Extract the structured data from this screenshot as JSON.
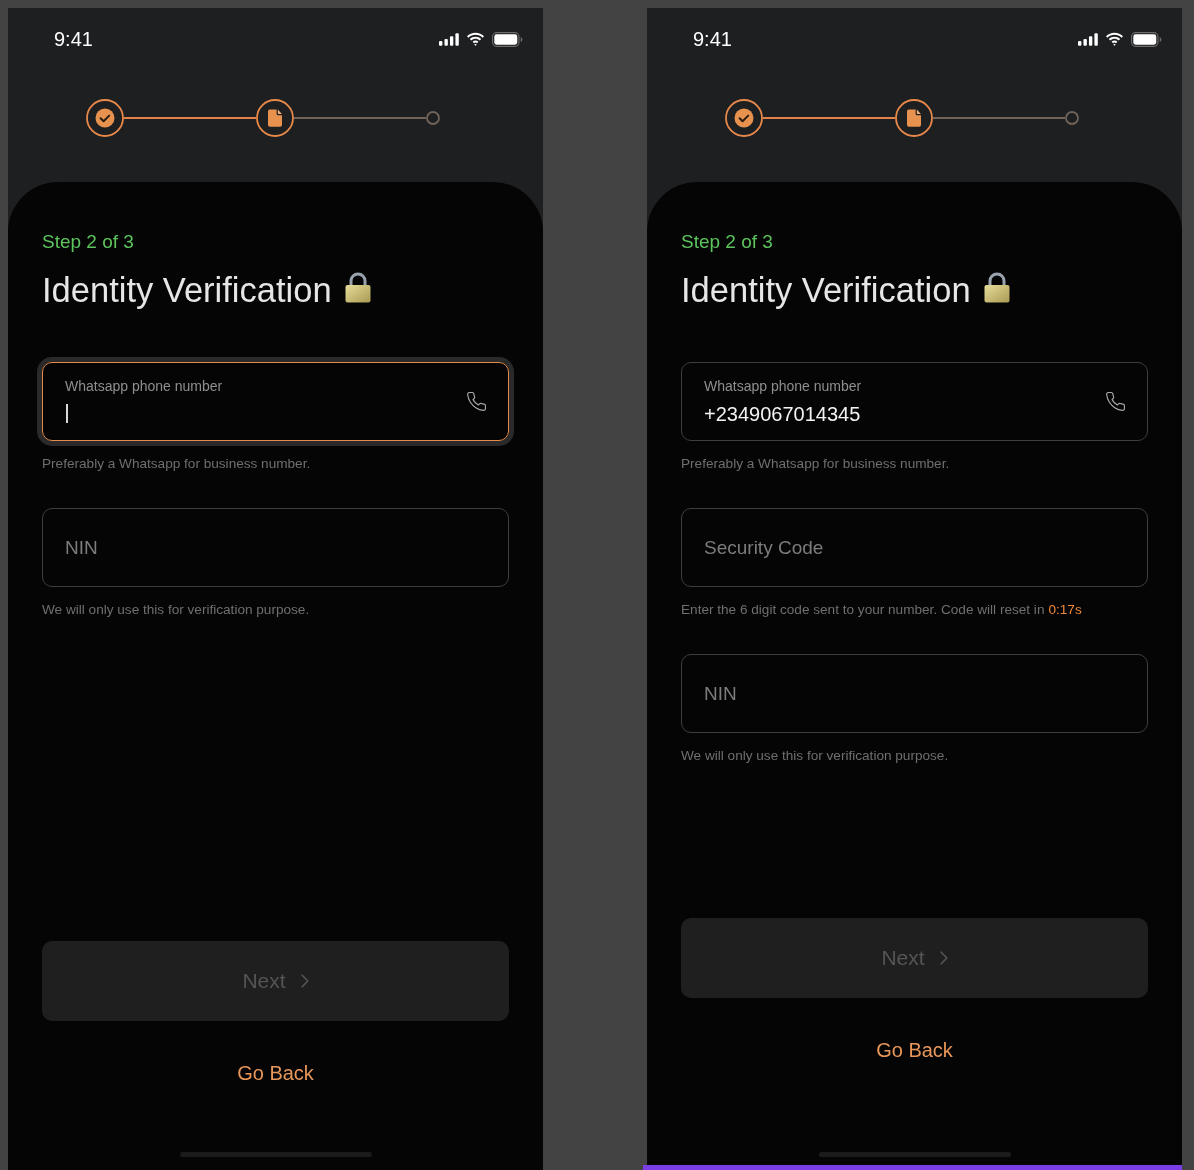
{
  "screens": [
    {
      "selected": false,
      "status_bar": {
        "time": "9:41"
      },
      "stepper": [
        {
          "kind": "done"
        },
        {
          "kind": "current"
        },
        {
          "kind": "pending"
        }
      ],
      "step_label": "Step 2 of 3",
      "title": "Identity Verification",
      "fields": [
        {
          "kind": "phone",
          "label": "Whatsapp phone number",
          "focused": true,
          "helper": "Preferably a Whatsapp for business number."
        },
        {
          "kind": "text",
          "placeholder": "NIN",
          "focused": false,
          "helper": "We will only use this for verification purpose."
        }
      ],
      "next_button": {
        "label": "Next",
        "disabled": true
      },
      "back_link": "Go Back"
    },
    {
      "selected": true,
      "status_bar": {
        "time": "9:41"
      },
      "stepper": [
        {
          "kind": "done"
        },
        {
          "kind": "current"
        },
        {
          "kind": "pending"
        }
      ],
      "step_label": "Step 2 of 3",
      "title": "Identity Verification",
      "fields": [
        {
          "kind": "phone",
          "label": "Whatsapp phone number",
          "value": "+2349067014345",
          "focused": false,
          "helper": "Preferably a Whatsapp for business number."
        },
        {
          "kind": "text",
          "placeholder": "Security Code",
          "focused": false,
          "helper": "Enter the 6 digit code sent to your number. Code will reset in",
          "countdown": "0:17s"
        },
        {
          "kind": "text",
          "placeholder": "NIN",
          "focused": false,
          "helper": "We will only use this for verification purpose."
        }
      ],
      "next_button": {
        "label": "Next",
        "disabled": true
      },
      "back_link": "Go Back"
    }
  ]
}
